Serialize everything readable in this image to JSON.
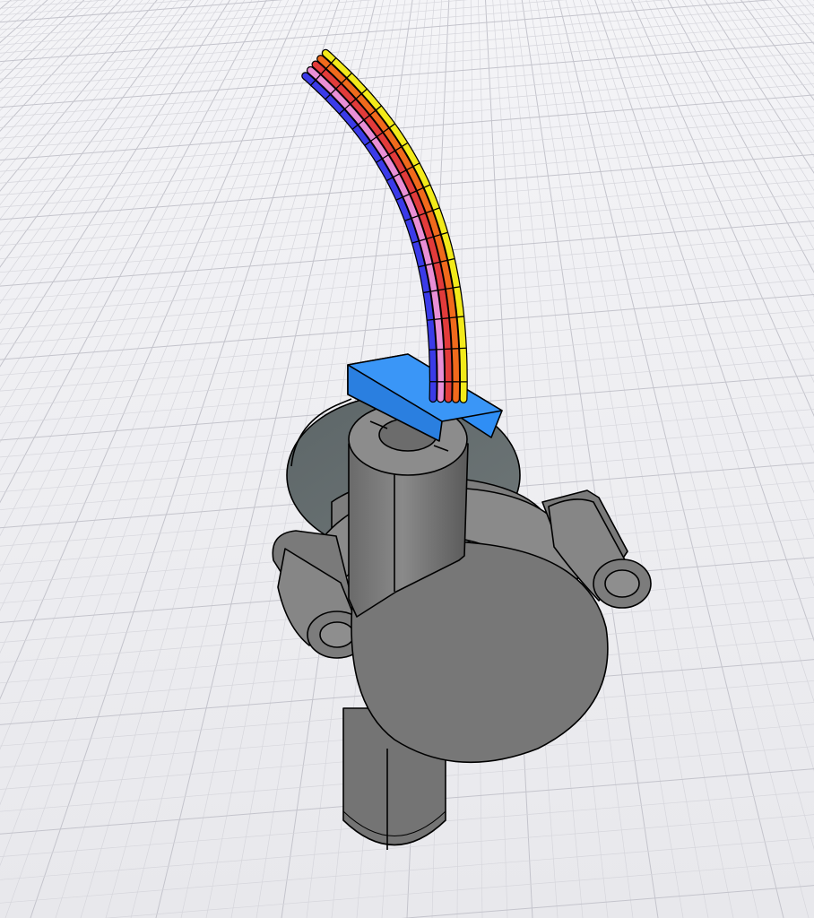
{
  "scene": {
    "background_color": "#eeedf1",
    "grid_color_minor": "#d6d6dc",
    "grid_color_major": "#c4c4cc",
    "grid_visible": true,
    "model_body_color": "#7a7a7a",
    "model_body_dark": "#5f6466",
    "connector_color": "#2f8ef5",
    "outline_color": "#000000"
  },
  "wires": [
    {
      "name": "yellow",
      "color": "#f2ea1a"
    },
    {
      "name": "orange",
      "color": "#f06a1c"
    },
    {
      "name": "red",
      "color": "#e23b3b"
    },
    {
      "name": "pink",
      "color": "#e98fd6"
    },
    {
      "name": "blue",
      "color": "#3b3be8"
    }
  ]
}
